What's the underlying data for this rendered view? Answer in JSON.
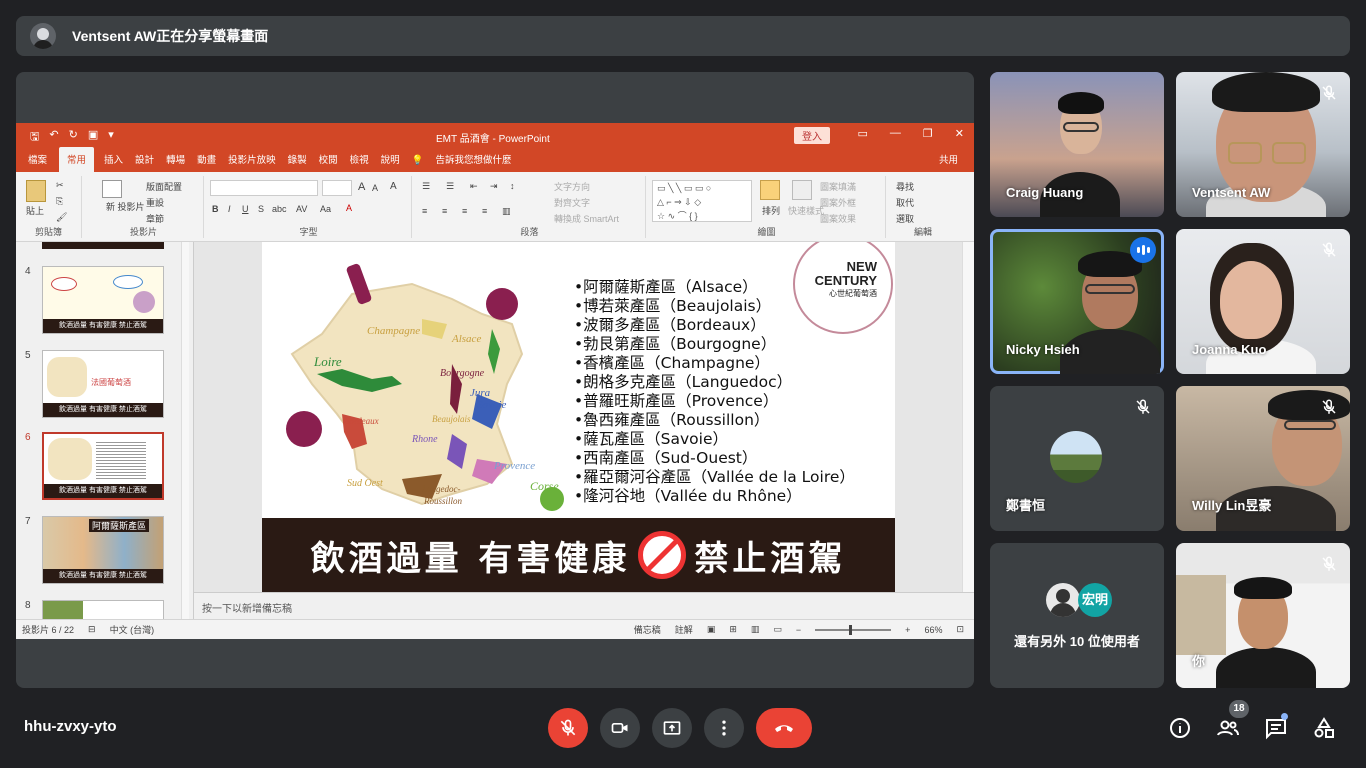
{
  "banner": {
    "text": "Ventsent AW正在分享螢幕畫面"
  },
  "ppt": {
    "window_title": "EMT 品酒會 - PowerPoint",
    "login": "登入",
    "tabs": [
      "檔案",
      "常用",
      "插入",
      "設計",
      "轉場",
      "動畫",
      "投影片放映",
      "錄製",
      "校閱",
      "檢視",
      "說明"
    ],
    "tell_me": "告訴我您想做什麼",
    "share": "共用",
    "ribbon": {
      "paste": "貼上",
      "new_slide": "新\n投影片",
      "layout": "版面配置",
      "reset": "重設",
      "section": "章節",
      "text_direction": "文字方向",
      "align_text": "對齊文字",
      "smartart": "轉換成 SmartArt",
      "arrange": "排列",
      "quick_styles": "快速樣式",
      "shape_fill": "圖案填滿",
      "shape_outline": "圖案外框",
      "shape_effects": "圖案效果",
      "find": "尋找",
      "replace": "取代",
      "select": "選取",
      "groups": [
        "剪貼簿",
        "投影片",
        "字型",
        "段落",
        "繪圖",
        "編輯"
      ]
    },
    "thumbnails": [
      {
        "num": "4",
        "caption": "飲酒過量 有害健康 禁止酒駕"
      },
      {
        "num": "5",
        "caption": "飲酒過量 有害健康 禁止酒駕",
        "title": "法國葡萄酒"
      },
      {
        "num": "6",
        "caption": "飲酒過量 有害健康 禁止酒駕"
      },
      {
        "num": "7",
        "caption": "飲酒過量 有害健康 禁止酒駕",
        "title": "阿爾薩斯產區"
      },
      {
        "num": "8"
      }
    ],
    "slide": {
      "regions": [
        "•阿爾薩斯產區（Alsace）",
        "•博若萊產區（Beaujolais）",
        "•波爾多產區（Bordeaux）",
        "•勃艮第產區（Bourgogne）",
        "•香檳產區（Champagne）",
        "•朗格多克產區（Languedoc）",
        "•普羅旺斯產區（Provence）",
        "•魯西雍產區（Roussillon）",
        "•薩瓦產區（Savoie）",
        "•西南產區（Sud-Ouest）",
        "•羅亞爾河谷產區（Vallée de la Loire）",
        "•隆河谷地（Vallée du Rhône）"
      ],
      "map_labels": [
        "Champagne",
        "Alsace",
        "Loire",
        "Bourgogne",
        "Jura",
        "Savoie",
        "Bordeaux",
        "Beaujolais",
        "Rhone",
        "Provence",
        "Sud Oest",
        "Langedoc-\nRoussillon",
        "Corse"
      ],
      "logo_line1": "NEW",
      "logo_line2": "CENTURY",
      "logo_line3": "心世紀葡萄酒",
      "warning_left": "飲酒過量 有害健康",
      "warning_right": "禁止酒駕"
    },
    "notes_placeholder": "按一下以新增備忘稿",
    "status": {
      "slide_count": "投影片 6 / 22",
      "language": "中文 (台灣)",
      "notes": "備忘稿",
      "comments": "註解",
      "zoom": "66%"
    }
  },
  "participants": [
    {
      "name": "Craig Huang",
      "muted": false
    },
    {
      "name": "Ventsent AW",
      "muted": true
    },
    {
      "name": "Nicky Hsieh",
      "muted": false,
      "speaking": true
    },
    {
      "name": "Joanna Kuo",
      "muted": true
    },
    {
      "name": "鄭書恒",
      "muted": true
    },
    {
      "name": "Willy Lin昱豪",
      "muted": true
    },
    {
      "name": "還有另外 10 位使用者",
      "avatar_text": "宏明"
    },
    {
      "name": "你",
      "muted": true
    }
  ],
  "meeting": {
    "code": "hhu-zvxy-yto",
    "people_count": "18"
  },
  "colors": {
    "background": "#202124",
    "tile": "#3c4043",
    "red": "#ea4335",
    "ppt_orange": "#d24726",
    "active_blue": "#8ab4f8"
  }
}
